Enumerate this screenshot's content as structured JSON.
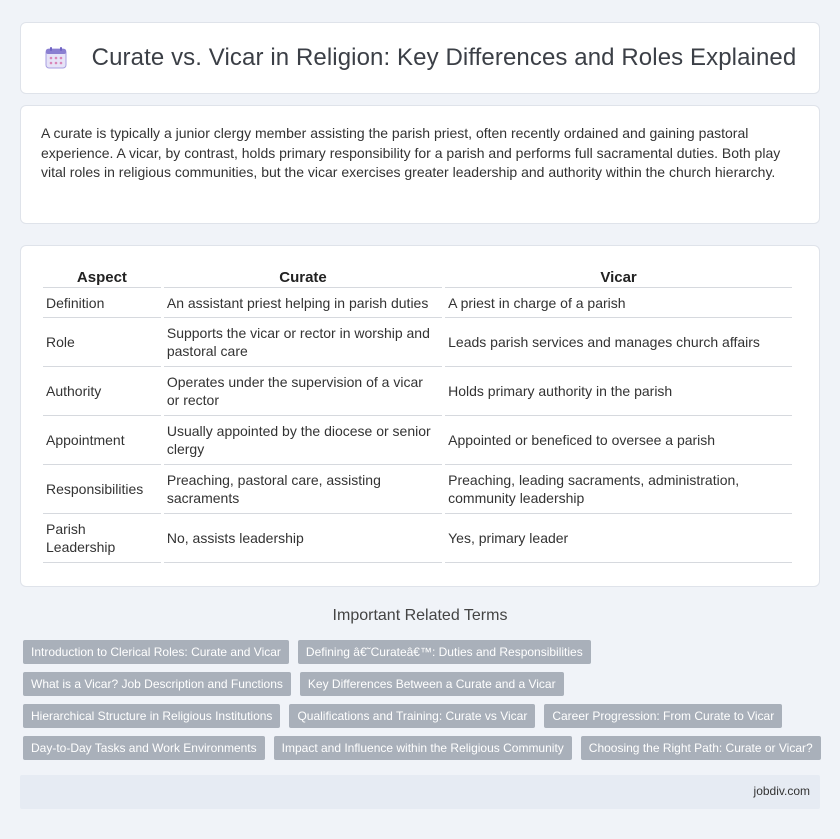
{
  "header": {
    "title": "Curate vs. Vicar in Religion: Key Differences and Roles Explained",
    "icon": "calendar-icon"
  },
  "intro": {
    "text": "A curate is typically a junior clergy member assisting the parish priest, often recently ordained and gaining pastoral experience. A vicar, by contrast, holds primary responsibility for a parish and performs full sacramental duties. Both play vital roles in religious communities, but the vicar exercises greater leadership and authority within the church hierarchy."
  },
  "table": {
    "headers": [
      "Aspect",
      "Curate",
      "Vicar"
    ],
    "rows": [
      [
        "Definition",
        "An assistant priest helping in parish duties",
        "A priest in charge of a parish"
      ],
      [
        "Role",
        "Supports the vicar or rector in worship and pastoral care",
        "Leads parish services and manages church affairs"
      ],
      [
        "Authority",
        "Operates under the supervision of a vicar or rector",
        "Holds primary authority in the parish"
      ],
      [
        "Appointment",
        "Usually appointed by the diocese or senior clergy",
        "Appointed or beneficed to oversee a parish"
      ],
      [
        "Responsibilities",
        "Preaching, pastoral care, assisting sacraments",
        "Preaching, leading sacraments, administration, community leadership"
      ],
      [
        "Parish Leadership",
        "No, assists leadership",
        "Yes, primary leader"
      ]
    ]
  },
  "related": {
    "title": "Important Related Terms",
    "tags": [
      "Introduction to Clerical Roles: Curate and Vicar",
      "Defining â€˜Curateâ€™: Duties and Responsibilities",
      "What is a Vicar? Job Description and Functions",
      "Key Differences Between a Curate and a Vicar",
      "Hierarchical Structure in Religious Institutions",
      "Qualifications and Training: Curate vs Vicar",
      "Career Progression: From Curate to Vicar",
      "Day-to-Day Tasks and Work Environments",
      "Impact and Influence within the Religious Community",
      "Choosing the Right Path: Curate or Vicar?"
    ]
  },
  "footer": {
    "site": "jobdiv.com"
  },
  "colors": {
    "background": "#f0f3f8",
    "tag": "#a9b0ba",
    "footer": "#e6ebf3",
    "icon_purple": "#8a7fd1"
  }
}
